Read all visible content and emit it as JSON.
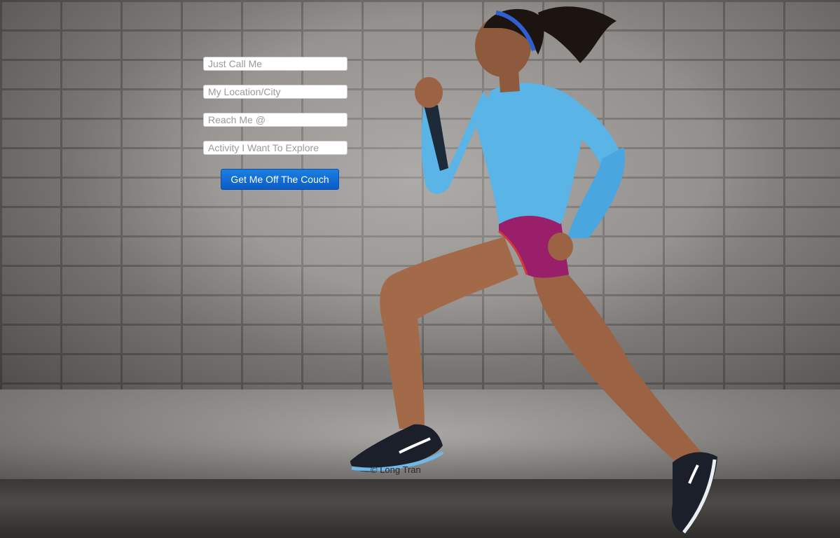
{
  "signup_form": {
    "name_placeholder": "Just Call Me",
    "location_placeholder": "My Location/City",
    "contact_placeholder": "Reach Me @",
    "activity_placeholder": "Activity I Want To Explore",
    "submit_label": "Get Me Off The Couch"
  },
  "footer": {
    "credit": "© Long Tran"
  },
  "colors": {
    "button": "#0a5cc6",
    "shirt": "#5ab4e6",
    "shorts": "#9a1f6a"
  }
}
